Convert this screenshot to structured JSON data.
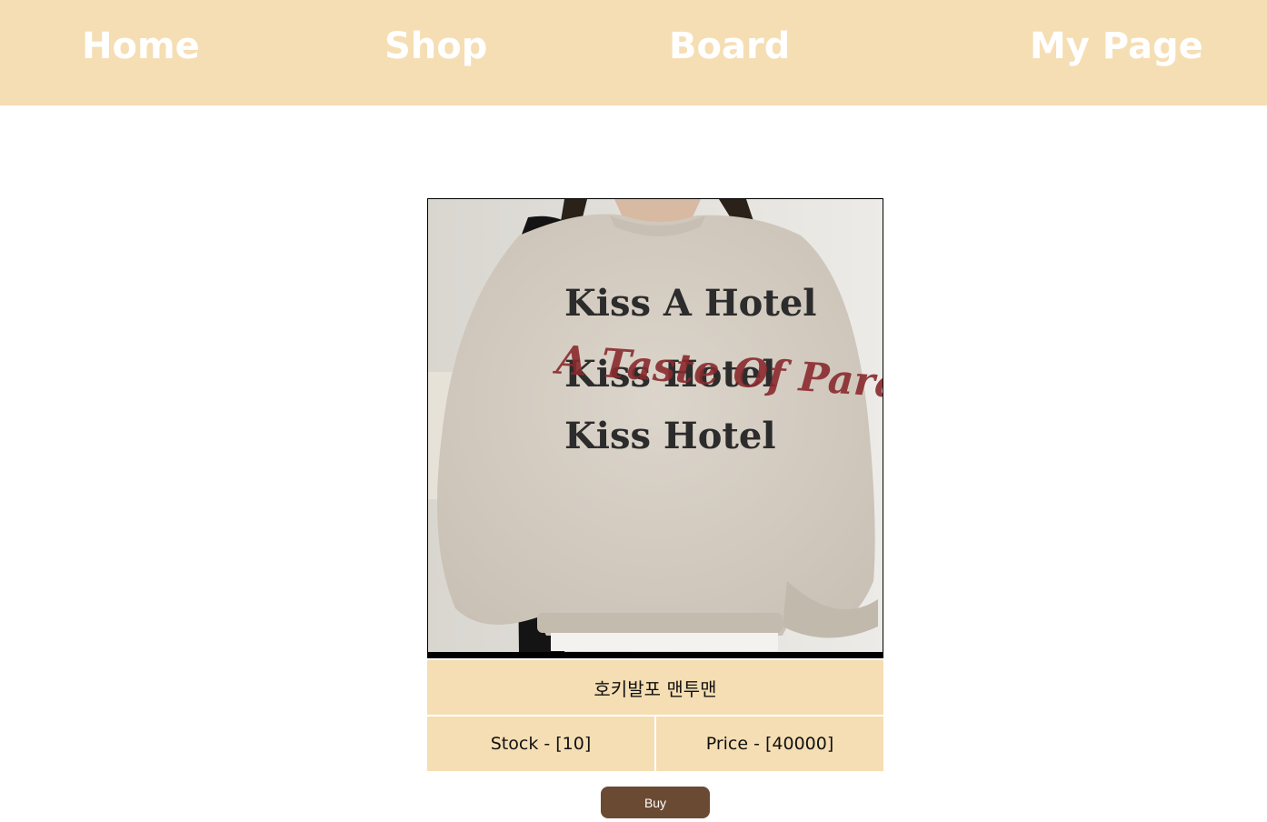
{
  "nav": {
    "home": "Home",
    "shop": "Shop",
    "board": "Board",
    "mypage": "My Page"
  },
  "product": {
    "image_print": {
      "line1": "Kiss A Hotel",
      "line2": "Kiss Hotel",
      "line3": "Kiss Hotel",
      "script": "A Taste Of Paradise"
    },
    "name": "호키발포 맨투맨",
    "stock_text": "Stock - [10]",
    "price_text": "Price - [40000]"
  },
  "actions": {
    "buy_label": "Buy"
  },
  "colors": {
    "nav_bg": "#f5deb3",
    "cell_bg": "#f5deb3",
    "button_bg": "#6b4a33",
    "nav_text": "#ffffff"
  }
}
